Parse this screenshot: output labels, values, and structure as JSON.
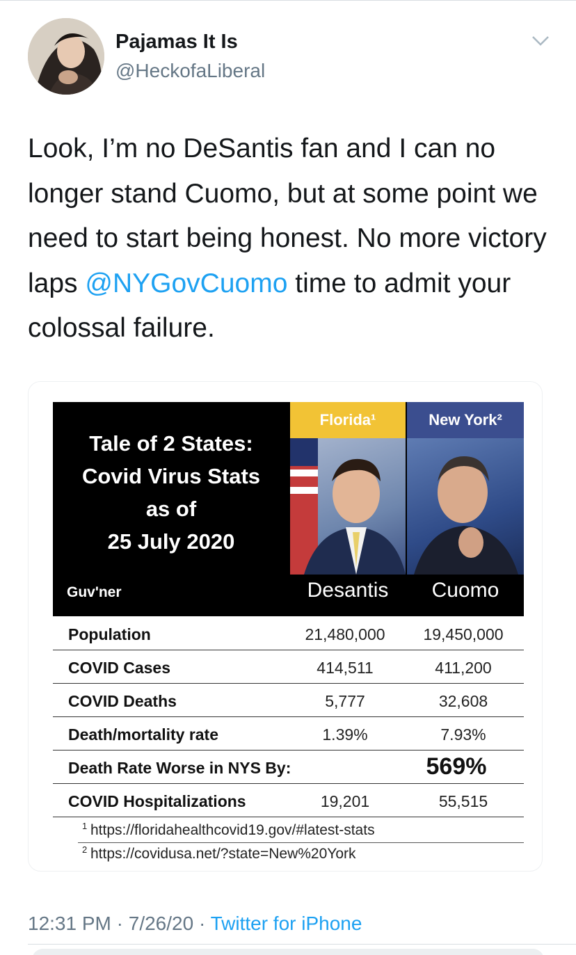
{
  "tweet": {
    "author": {
      "display_name": "Pajamas It Is",
      "handle": "@HeckofaLiberal",
      "avatar_icon": "avatar-photo"
    },
    "menu_icon": "chevron-down-icon",
    "text_parts": [
      "Look, I’m no DeSantis fan and I can no longer stand Cuomo, but at some point we need to start being honest. No more victory laps ",
      "@NYGovCuomo",
      " time to admit your colossal failure."
    ],
    "media": {
      "title_lines": [
        "Tale of 2 States:",
        "Covid Virus Stats",
        "as of",
        "25 July 2020"
      ],
      "florida_header": "Florida¹",
      "newyork_header": "New York²",
      "guv_label": "Guv'ner",
      "guv_florida": "Desantis",
      "guv_newyork": "Cuomo",
      "rows": [
        {
          "label": "Population",
          "florida": "21,480,000",
          "newyork": "19,450,000"
        },
        {
          "label": "COVID Cases",
          "florida": "414,511",
          "newyork": "411,200"
        },
        {
          "label": "COVID Deaths",
          "florida": "5,777",
          "newyork": "32,608"
        },
        {
          "label": "Death/mortality rate",
          "florida": "1.39%",
          "newyork": "7.93%"
        }
      ],
      "worse_row": {
        "label": "Death Rate Worse in NYS By:",
        "value": "569%"
      },
      "hosp_row": {
        "label": "COVID Hospitalizations",
        "florida": "19,201",
        "newyork": "55,515"
      },
      "footnotes": [
        {
          "mark": "1",
          "url": "https://floridahealthcovid19.gov/#latest-stats"
        },
        {
          "mark": "2",
          "url": "https://covidusa.net/?state=New%20York"
        }
      ],
      "colors": {
        "florida": "#f2c335",
        "newyork": "#3b4e8f"
      }
    },
    "time": "12:31 PM",
    "date": "7/26/20",
    "separator": "·",
    "source": "Twitter for iPhone"
  },
  "colors": {
    "link": "#1da1f2",
    "muted": "#657786",
    "text": "#14171a"
  }
}
